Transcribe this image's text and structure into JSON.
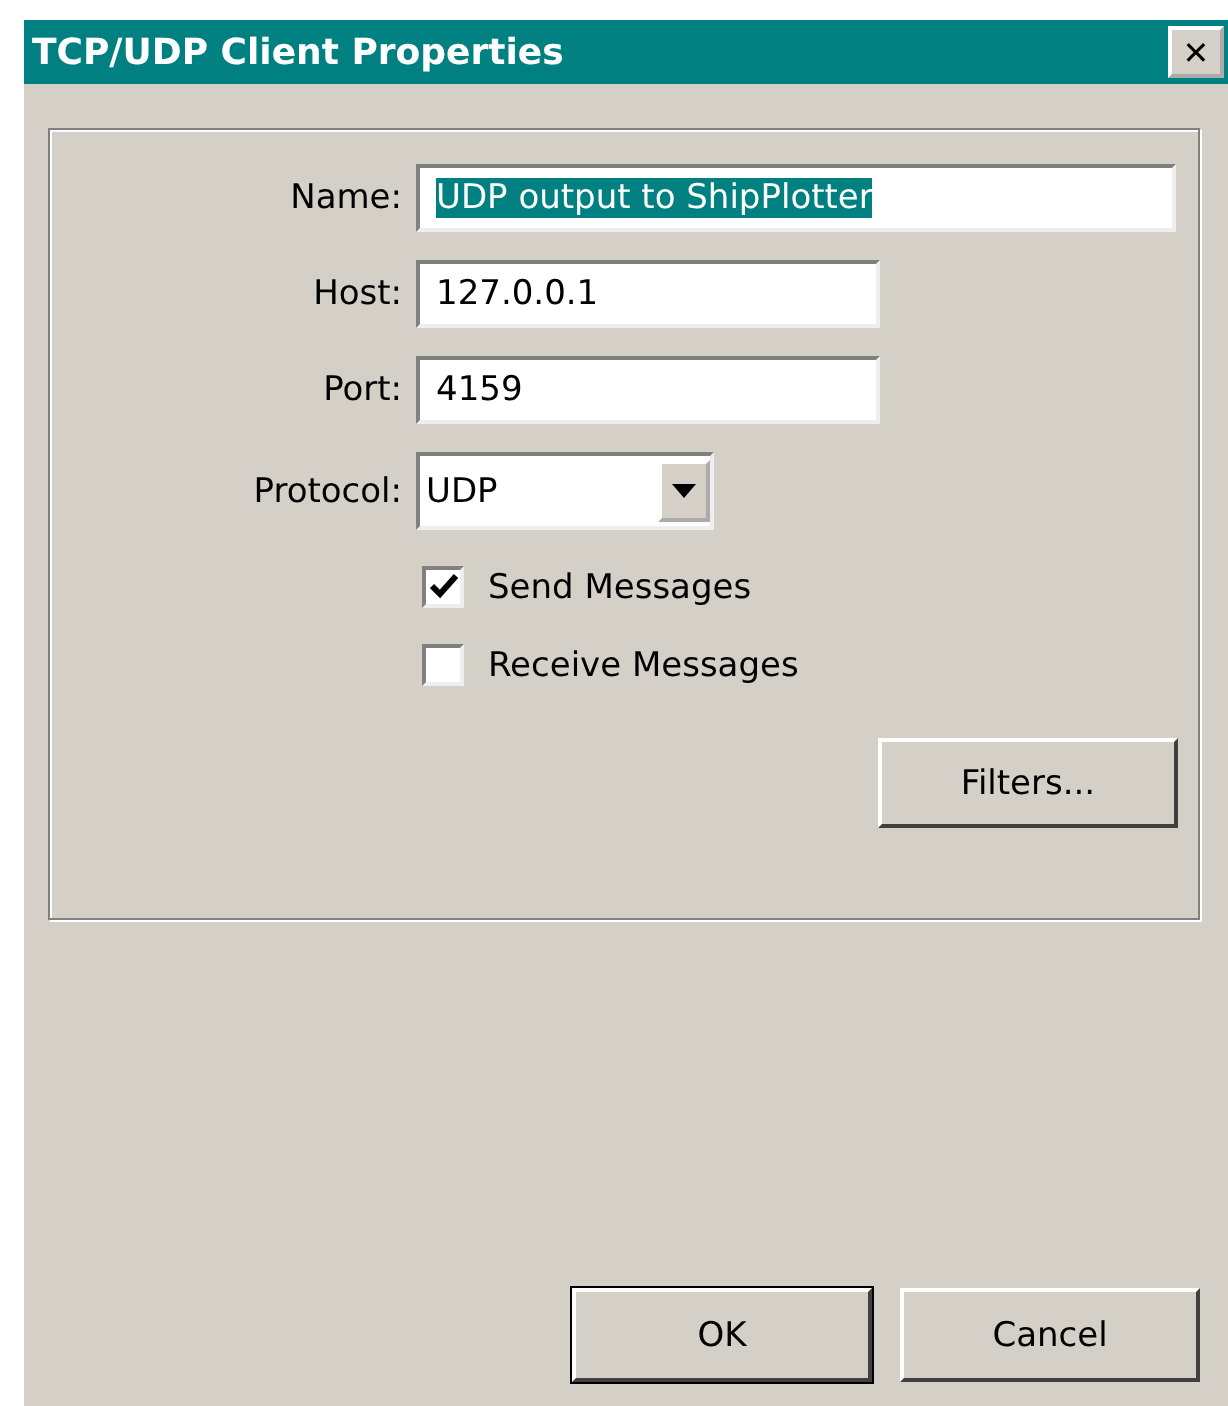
{
  "window": {
    "title": "TCP/UDP Client Properties",
    "close": "✕"
  },
  "fields": [
    {
      "kind": "text",
      "label": "Name:",
      "value": "UDP output to ShipPlotter",
      "selected": true
    },
    {
      "kind": "text",
      "label": "Host:",
      "value": "127.0.0.1",
      "selected": false
    },
    {
      "kind": "text",
      "label": "Port:",
      "value": "4159",
      "selected": false
    },
    {
      "kind": "combo",
      "label": "Protocol:",
      "value": "UDP"
    }
  ],
  "checkboxes": [
    {
      "label": "Send Messages",
      "checked": true
    },
    {
      "label": "Receive Messages",
      "checked": false
    }
  ],
  "filters_button": "Filters...",
  "buttons": [
    {
      "label": "OK",
      "default": true
    },
    {
      "label": "Cancel",
      "default": false
    }
  ]
}
